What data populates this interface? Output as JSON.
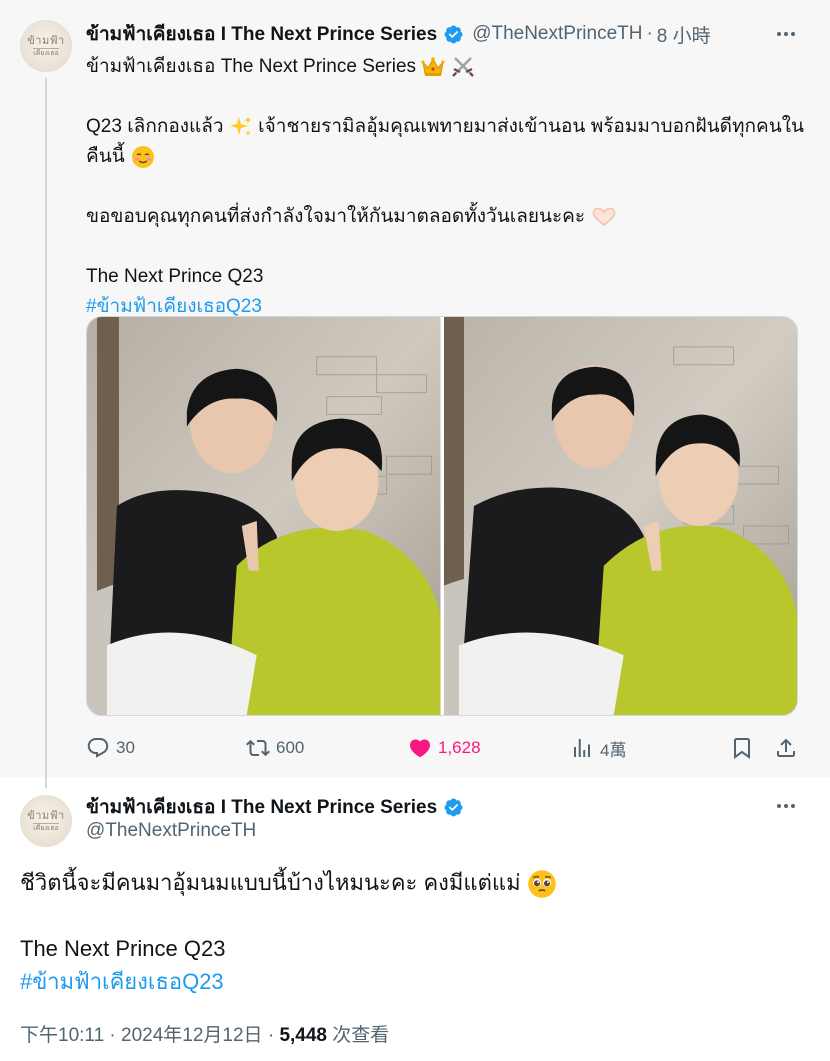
{
  "tweet1": {
    "display_name": "ข้ามฟ้าเคียงเธอ I The Next Prince Series",
    "handle": "@TheNextPrinceTH",
    "dot": "·",
    "time": "8 小時",
    "avatar_logo_top": "ข้ามฟ้า",
    "avatar_logo_bottom": "เคียงเธอ",
    "line1": "ข้ามฟ้าเคียงเธอ The Next Prince Series",
    "line2": "Q23 เลิกกองแล้ว",
    "line2b": "เจ้าชายรามิลอุ้มคุณเพทายมาส่งเข้านอน พร้อมมาบอกฝันดีทุกคนในคืนนี้",
    "line3": "ขอขอบคุณทุกคนที่ส่งกำลังใจมาให้กันมาตลอดทั้งวันเลยนะคะ",
    "line4": "The Next Prince Q23",
    "hashtag": "#ข้ามฟ้าเคียงเธอQ23",
    "stats": {
      "replies": "30",
      "retweets": "600",
      "likes": "1,628",
      "views": "4萬"
    }
  },
  "tweet2": {
    "display_name": "ข้ามฟ้าเคียงเธอ I The Next Prince Series",
    "handle": "@TheNextPrinceTH",
    "avatar_logo_top": "ข้ามฟ้า",
    "avatar_logo_bottom": "เคียงเธอ",
    "line1": "ชีวิตนี้จะมีคนมาอุ้มนมแบบนี้บ้างไหมนะคะ คงมีแต่แม่",
    "line2": "The Next Prince Q23",
    "hashtag": "#ข้ามฟ้าเคียงเธอQ23",
    "timestamp": "下午10:11 · 2024年12月12日",
    "dot": "·",
    "views_count": "5,448",
    "views_label": "次查看"
  },
  "colors": {
    "link": "#1d9bf0",
    "like": "#f91880",
    "secondary_text": "#536471",
    "verified": "#1d9bf0"
  },
  "icons": [
    "verified-badge-icon",
    "more-icon",
    "reply-icon",
    "retweet-icon",
    "like-icon",
    "views-icon",
    "bookmark-icon",
    "share-icon",
    "crown-emoji",
    "swords-emoji",
    "sparkles-emoji",
    "smiling-face-emoji",
    "heart-hands-emoji",
    "pleading-face-emoji"
  ]
}
